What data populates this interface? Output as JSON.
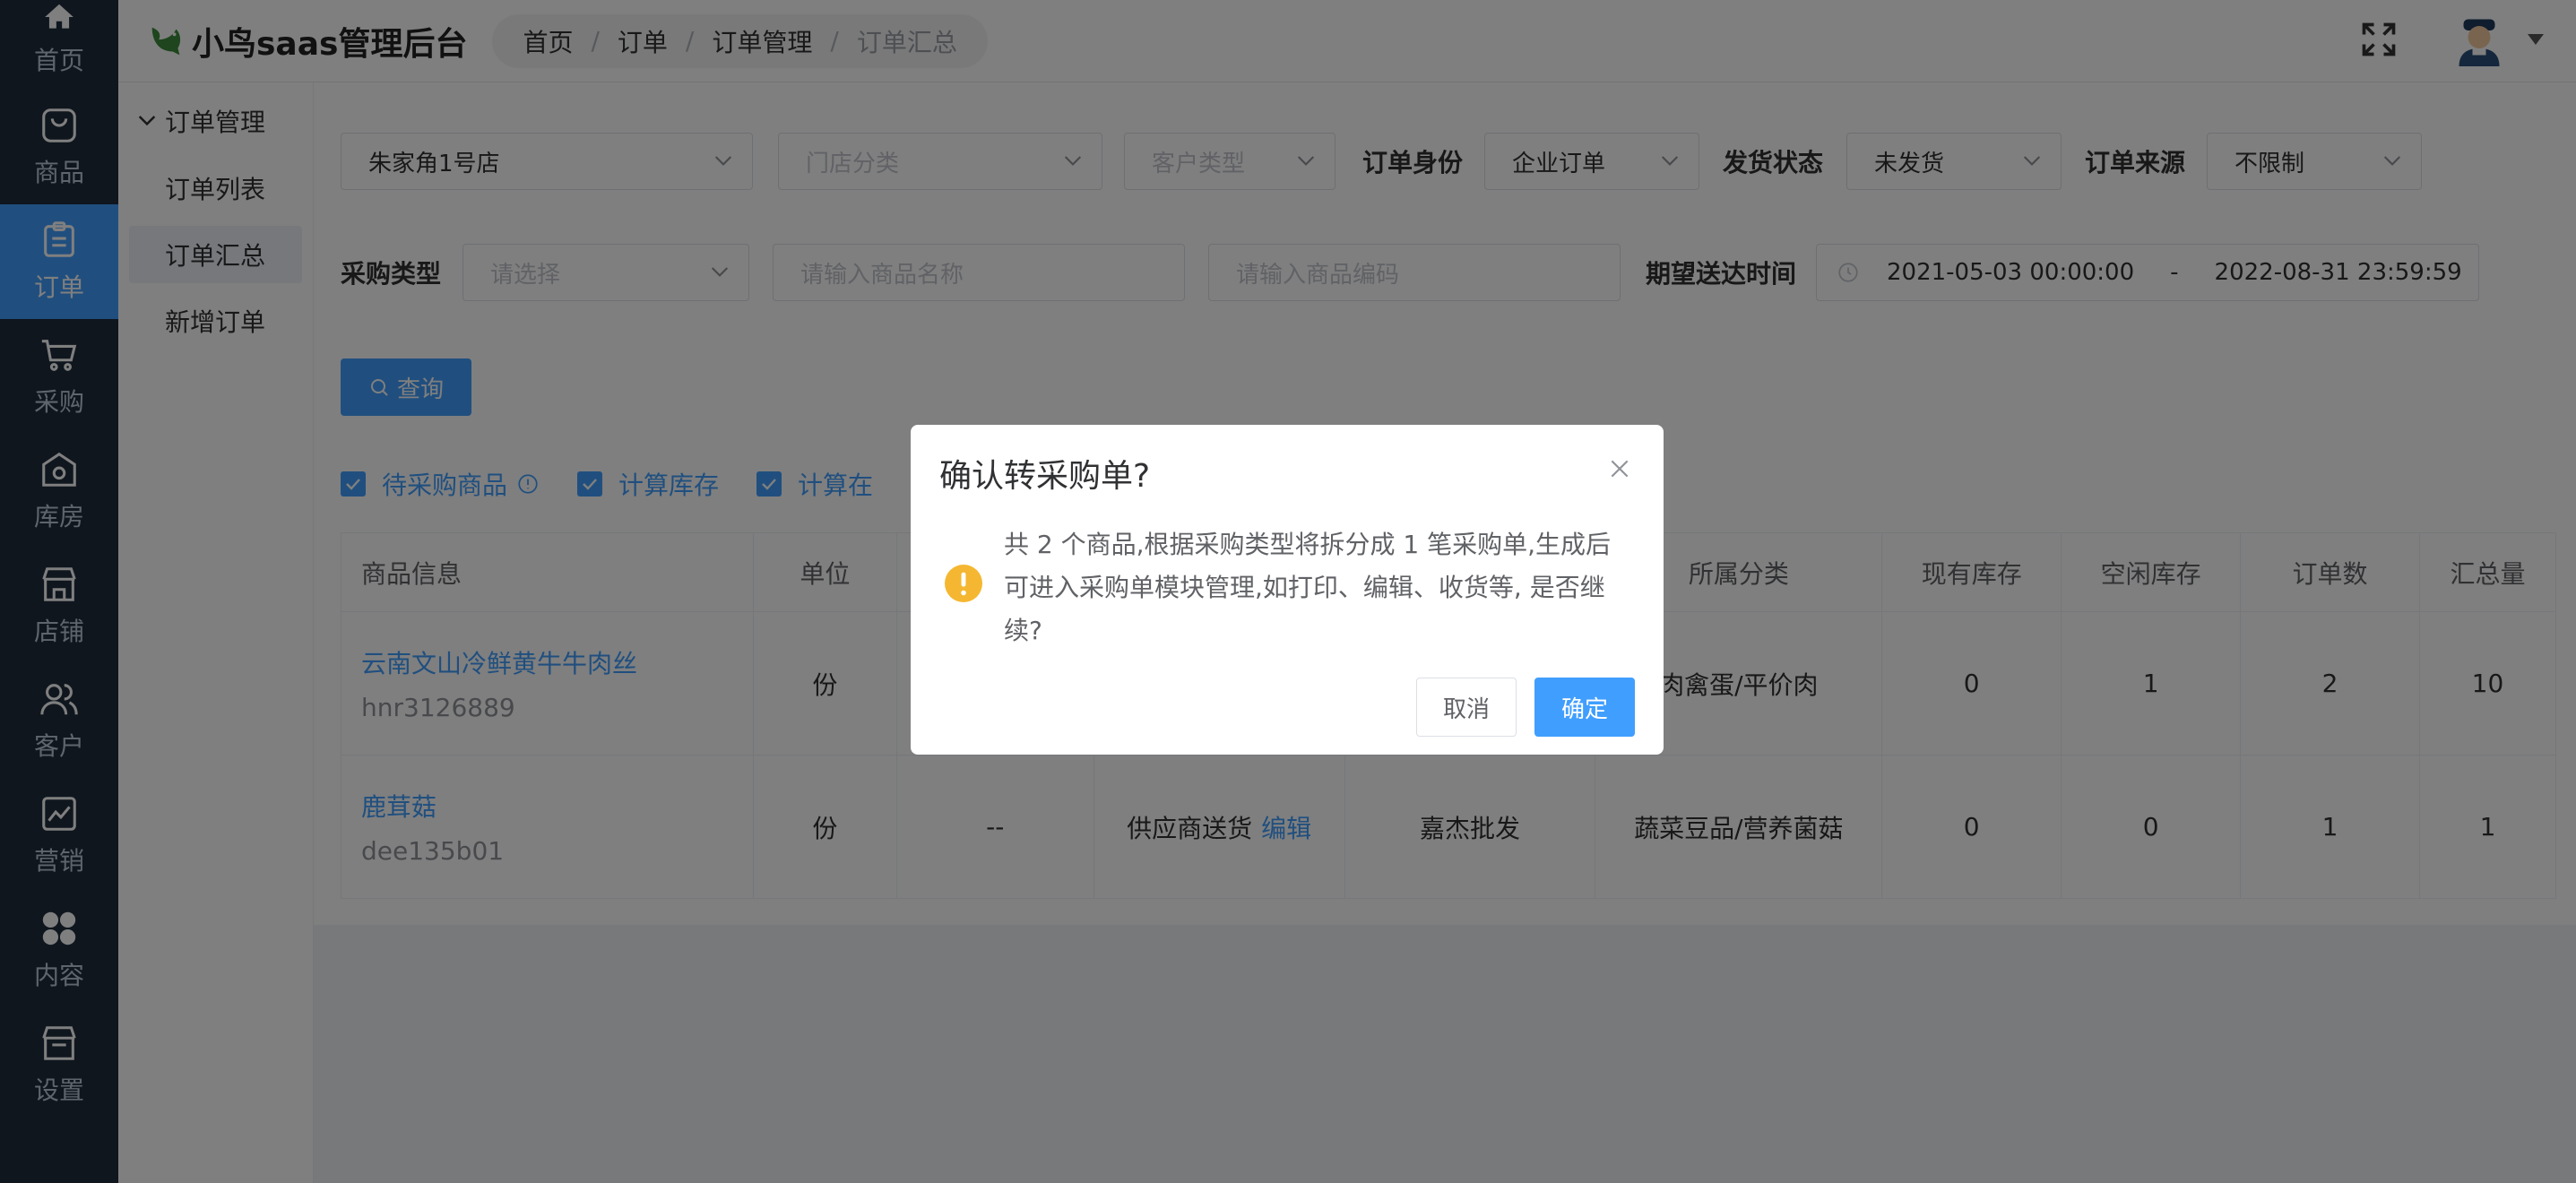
{
  "nav": {
    "items": [
      {
        "label": "首页",
        "icon": "home-icon"
      },
      {
        "label": "商品",
        "icon": "bag-icon"
      },
      {
        "label": "订单",
        "icon": "clipboard-icon",
        "active": true
      },
      {
        "label": "采购",
        "icon": "cart-icon"
      },
      {
        "label": "库房",
        "icon": "warehouse-icon"
      },
      {
        "label": "店铺",
        "icon": "store-icon"
      },
      {
        "label": "客户",
        "icon": "users-icon"
      },
      {
        "label": "营销",
        "icon": "chart-icon"
      },
      {
        "label": "内容",
        "icon": "grid-icon"
      },
      {
        "label": "设置",
        "icon": "settings-icon"
      }
    ]
  },
  "header": {
    "logo_text": "小鸟saas管理后台",
    "breadcrumb": [
      "首页",
      "订单",
      "订单管理",
      "订单汇总"
    ]
  },
  "submenu": {
    "title": "订单管理",
    "items": [
      "订单列表",
      "订单汇总",
      "新增订单"
    ]
  },
  "filters": {
    "store": "朱家角1号店",
    "store_category_placeholder": "门店分类",
    "customer_type_placeholder": "客户类型",
    "order_identity_label": "订单身份",
    "order_identity_value": "企业订单",
    "ship_status_label": "发货状态",
    "ship_status_value": "未发货",
    "order_source_label": "订单来源",
    "order_source_value": "不限制",
    "purchase_type_label": "采购类型",
    "purchase_type_placeholder": "请选择",
    "product_name_placeholder": "请输入商品名称",
    "product_code_placeholder": "请输入商品编码",
    "delivery_time_label": "期望送达时间",
    "date_start": "2021-05-03 00:00:00",
    "date_sep": "-",
    "date_end": "2022-08-31 23:59:59",
    "query_label": "查询"
  },
  "checks": [
    "待采购商品",
    "计算库存",
    "计算在"
  ],
  "table": {
    "headers": [
      "商品信息",
      "单位",
      "",
      "",
      "",
      "所属分类",
      "现有库存",
      "空闲库存",
      "订单数",
      "汇总量"
    ],
    "rows": [
      {
        "name": "云南文山冷鲜黄牛牛肉丝",
        "code": "hnr3126889",
        "unit": "份",
        "purchase": "",
        "supply": "",
        "supplier": "",
        "category": "肉禽蛋/平价肉",
        "stock": "0",
        "free": "1",
        "orders": "2",
        "total": "10"
      },
      {
        "name": "鹿茸菇",
        "code": "dee135b01",
        "unit": "份",
        "purchase": "--",
        "supply": "供应商送货",
        "edit": "编辑",
        "supplier": "嘉杰批发",
        "category": "蔬菜豆品/营养菌菇",
        "stock": "0",
        "free": "0",
        "orders": "1",
        "total": "1"
      }
    ]
  },
  "dialog": {
    "title": "确认转采购单?",
    "message": "共 2 个商品,根据采购类型将拆分成 1 笔采购单,生成后可进入采购单模块管理,如打印、编辑、收货等, 是否继续?",
    "cancel": "取消",
    "confirm": "确定"
  },
  "colors": {
    "primary": "#409eff",
    "nav_bg": "#1f2d3d",
    "warning": "#f5b731"
  }
}
